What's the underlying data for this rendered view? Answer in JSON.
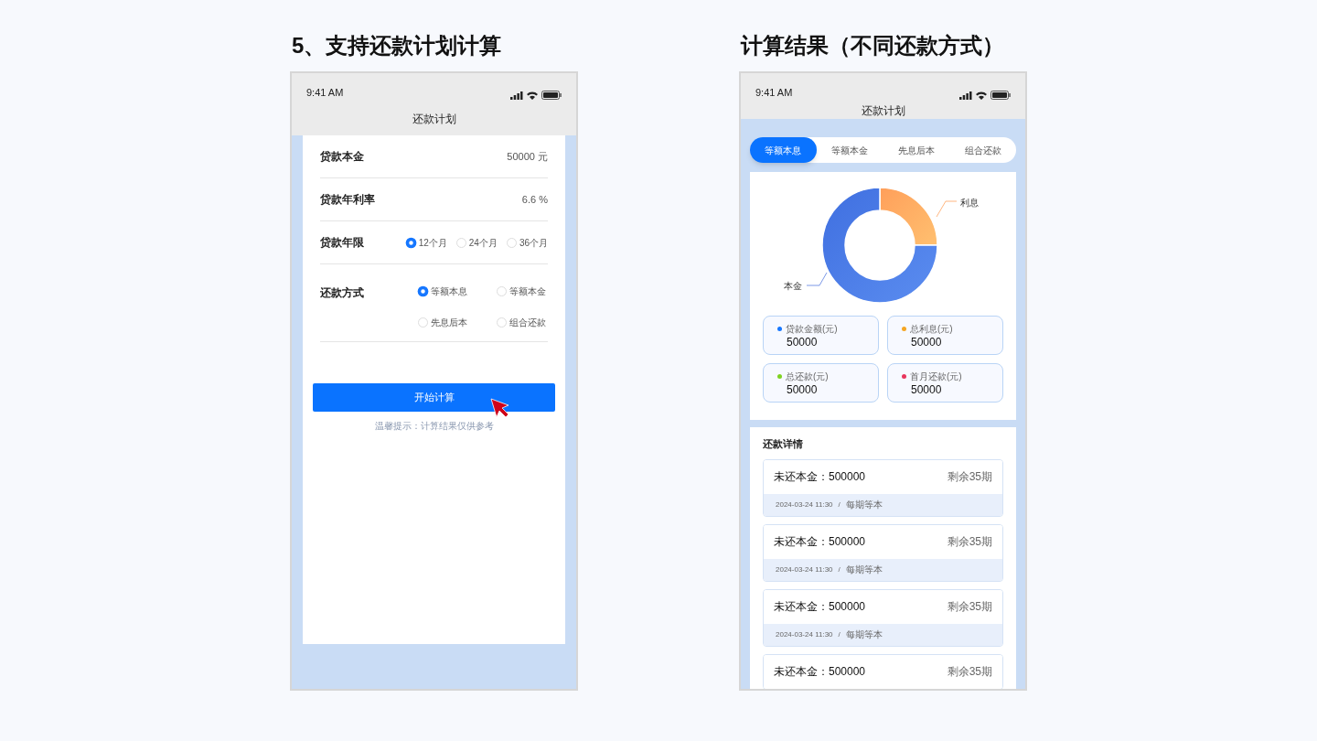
{
  "left_panel": {
    "heading": "5、支持还款计划计算",
    "phone": {
      "status_time": "9:41 AM",
      "title": "还款计划",
      "fields": [
        {
          "kind": "value",
          "label": "贷款本金",
          "value": "50000 元"
        },
        {
          "kind": "value",
          "label": "贷款年利率",
          "value": "6.6 %"
        },
        {
          "kind": "radio",
          "label": "贷款年限",
          "options": [
            {
              "label": "12个月",
              "selected": true
            },
            {
              "label": "24个月",
              "selected": false
            },
            {
              "label": "36个月",
              "selected": false
            }
          ]
        },
        {
          "kind": "radio_grid",
          "label": "还款方式",
          "options": [
            {
              "label": "等额本息",
              "selected": true
            },
            {
              "label": "等额本金",
              "selected": false
            },
            {
              "label": "先息后本",
              "selected": false
            },
            {
              "label": "组合还款",
              "selected": false
            }
          ]
        }
      ],
      "button": "开始计算",
      "hint": "温馨提示：计算结果仅供参考"
    }
  },
  "right_panel": {
    "heading": "计算结果（不同还款方式）",
    "phone": {
      "status_time": "9:41 AM",
      "title": "还款计划",
      "tabs": [
        {
          "label": "等额本息",
          "selected": true
        },
        {
          "label": "等额本金",
          "selected": false
        },
        {
          "label": "先息后本",
          "selected": false
        },
        {
          "label": "组合还款",
          "selected": false
        }
      ],
      "donut_labels": {
        "interest": "利息",
        "principal": "本金"
      },
      "stats": [
        {
          "label": "贷款金额(元)",
          "value": "50000",
          "color": "#1677ff"
        },
        {
          "label": "总利息(元)",
          "value": "50000",
          "color": "#f5a623"
        },
        {
          "label": "总还款(元)",
          "value": "50000",
          "color": "#7ed321"
        },
        {
          "label": "首月还款(元)",
          "value": "50000",
          "color": "#e8365d"
        }
      ],
      "details_title": "还款详情",
      "details": [
        {
          "principal": "未还本金：500000",
          "remaining": "剩余35期",
          "date": "2024-03-24 11:30",
          "separator": "/",
          "note": "每期等本"
        },
        {
          "principal": "未还本金：500000",
          "remaining": "剩余35期",
          "date": "2024-03-24 11:30",
          "separator": "/",
          "note": "每期等本"
        },
        {
          "principal": "未还本金：500000",
          "remaining": "剩余35期",
          "date": "2024-03-24 11:30",
          "separator": "/",
          "note": "每期等本"
        },
        {
          "principal": "未还本金：500000",
          "remaining": "剩余35期"
        }
      ]
    }
  }
}
